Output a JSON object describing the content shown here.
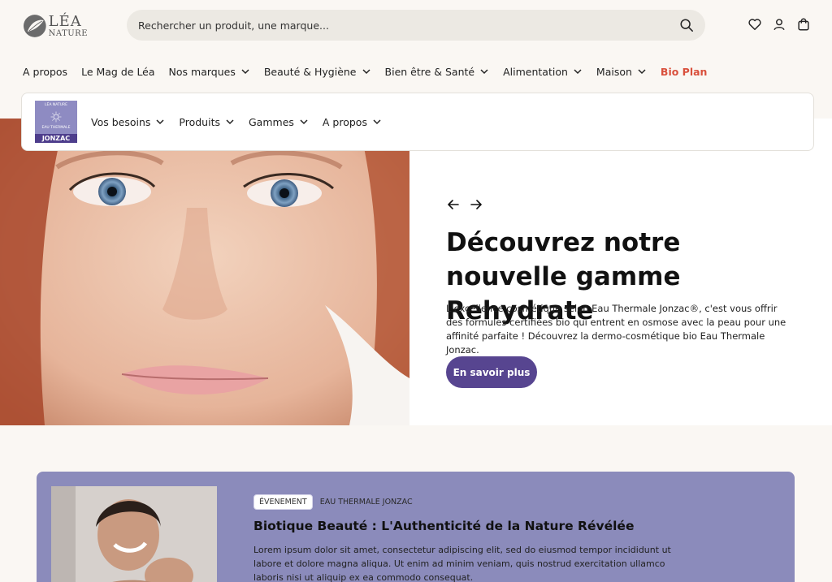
{
  "header": {
    "logo_line1": "LÉA",
    "logo_line2": "NATURE",
    "search_placeholder": "Rechercher un produit, une marque..."
  },
  "main_nav": {
    "items": [
      {
        "label": "A propos"
      },
      {
        "label": "Le Mag de Léa"
      },
      {
        "label": "Nos marques"
      },
      {
        "label": "Beauté & Hygiène"
      },
      {
        "label": "Bien être & Santé"
      },
      {
        "label": "Alimentation"
      },
      {
        "label": "Maison"
      },
      {
        "label": "Bio Plan"
      }
    ]
  },
  "sub_nav": {
    "brand_line1": "LÉA NATURE",
    "brand_line2": "EAU THERMALE",
    "brand_line3": "JONZAC",
    "items": [
      {
        "label": "Vos besoins"
      },
      {
        "label": "Produits"
      },
      {
        "label": "Gammes"
      },
      {
        "label": "A propos"
      }
    ]
  },
  "hero": {
    "title": "Découvrez notre nouvelle gamme Rehydrate",
    "body": "L'excellence cosmétique selon Eau Thermale Jonzac®, c'est vous offrir des formules certifiées bio qui entrent en osmose avec la peau pour une affinité parfaite !  Découvrez la dermo-cosmétique bio Eau Thermale Jonzac.",
    "cta_label": "En savoir plus"
  },
  "event": {
    "tag": "ÉVENEMENT",
    "brand": "EAU THERMALE JONZAC",
    "title": "Biotique Beauté : L'Authenticité de la Nature Révélée",
    "body": "Lorem ipsum dolor sit amet, consectetur adipiscing elit, sed do eiusmod tempor incididunt ut labore et dolore magna aliqua. Ut enim ad minim veniam, quis nostrud exercitation ullamco laboris nisi ut aliquip ex ea commodo consequat."
  },
  "colors": {
    "background": "#faf7f3",
    "accent_purple": "#574590",
    "event_bg": "#8b8bbb",
    "bio_plan": "#d9503c",
    "search_bg": "#ece9e3"
  },
  "icons": [
    "search-icon",
    "heart-icon",
    "user-icon",
    "cart-icon",
    "chevron-down-icon",
    "arrow-left-icon",
    "arrow-right-icon"
  ]
}
